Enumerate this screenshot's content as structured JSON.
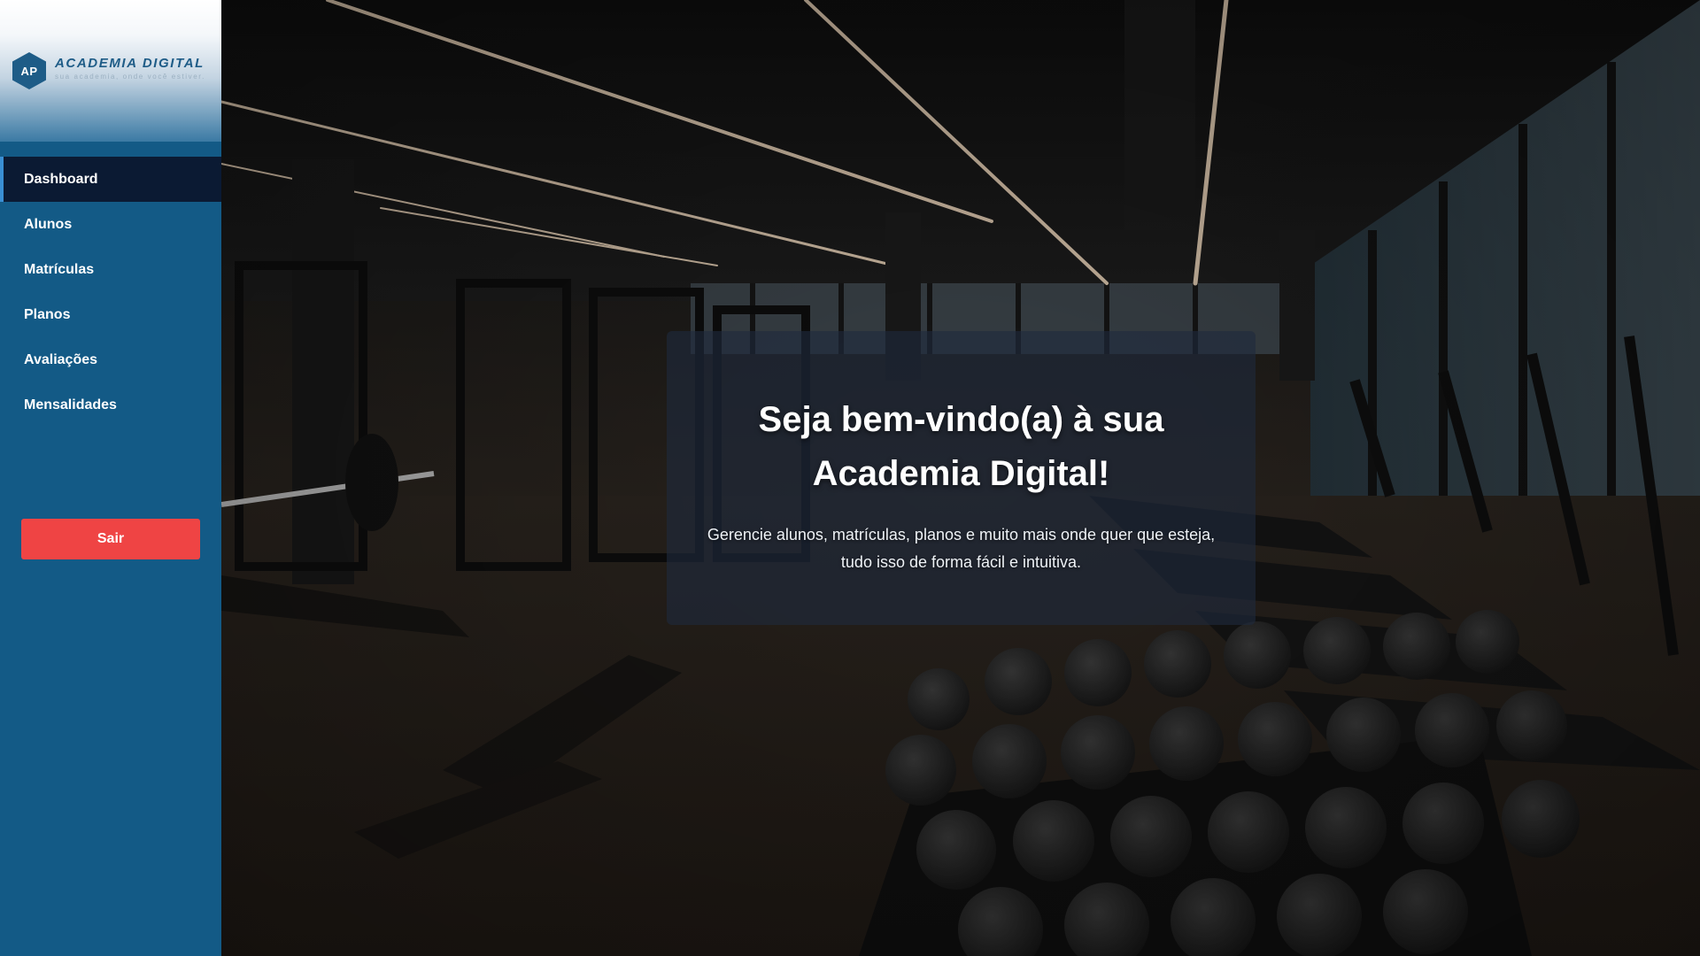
{
  "brand": {
    "logo_initials": "AP",
    "name": "ACADEMIA DIGITAL",
    "tagline": "sua academia, onde você estiver."
  },
  "sidebar": {
    "items": [
      {
        "label": "Dashboard",
        "active": true
      },
      {
        "label": "Alunos",
        "active": false
      },
      {
        "label": "Matrículas",
        "active": false
      },
      {
        "label": "Planos",
        "active": false
      },
      {
        "label": "Avaliações",
        "active": false
      },
      {
        "label": "Mensalidades",
        "active": false
      }
    ],
    "logout_label": "Sair"
  },
  "welcome": {
    "title": "Seja bem-vindo(a) à sua Academia Digital!",
    "subtitle": "Gerencie alunos, matrículas, planos e muito mais onde quer que esteja, tudo isso de forma fácil e intuitiva."
  },
  "colors": {
    "sidebar_bg": "#135a86",
    "nav_active_bg": "#0b1a33",
    "brand_blue": "#1e5c87",
    "logout_red": "#ef4444",
    "card_bg": "rgba(30, 42, 62, 0.62)"
  }
}
